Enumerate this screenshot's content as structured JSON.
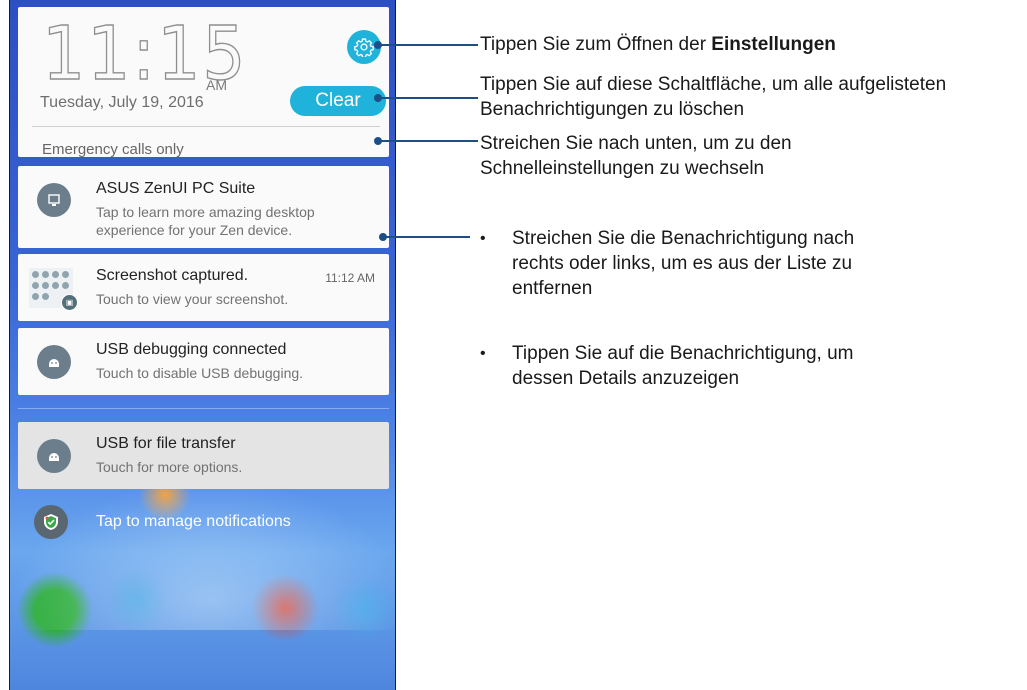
{
  "lockscreen": {
    "time": "11:15",
    "ampm": "AM",
    "date": "Tuesday, July 19, 2016",
    "clear_label": "Clear",
    "emergency": "Emergency calls only"
  },
  "notifications": [
    {
      "title": "ASUS ZenUI PC Suite",
      "line1": "Tap to learn more amazing desktop",
      "line2": "experience for your Zen device.",
      "icon": "pc-suite-icon"
    },
    {
      "title": "Screenshot captured.",
      "line1": "Touch to view your screenshot.",
      "time": "11:12 AM",
      "icon": "screenshot-thumbnail"
    },
    {
      "title": "USB debugging connected",
      "line1": "Touch to disable USB debugging.",
      "icon": "android-icon"
    },
    {
      "title": "USB for file transfer",
      "line1": "Touch for more options.",
      "icon": "android-icon"
    }
  ],
  "manage_label": "Tap to manage notifications",
  "annotations": {
    "settings_prefix": "Tippen Sie zum Öffnen der ",
    "settings_bold": "Einstellungen",
    "clear_line1": "Tippen Sie auf diese Schaltfläche, um alle aufgelisteten",
    "clear_line2": "Benachrichtigungen zu löschen",
    "swipe_line1": "Streichen Sie nach unten, um zu den",
    "swipe_line2": "Schnelleinstellungen zu wechseln",
    "bullet": "•",
    "b1_line1": "Streichen Sie die Benachrichtigung nach",
    "b1_line2": "rechts oder links, um es aus der Liste zu",
    "b1_line3": "entfernen",
    "b2_line1": "Tippen Sie auf die Benachrichtigung, um",
    "b2_line2": "dessen Details anzuzeigen"
  },
  "colors": {
    "accent": "#1fb3dc",
    "annotation_line": "#1c4e88"
  }
}
